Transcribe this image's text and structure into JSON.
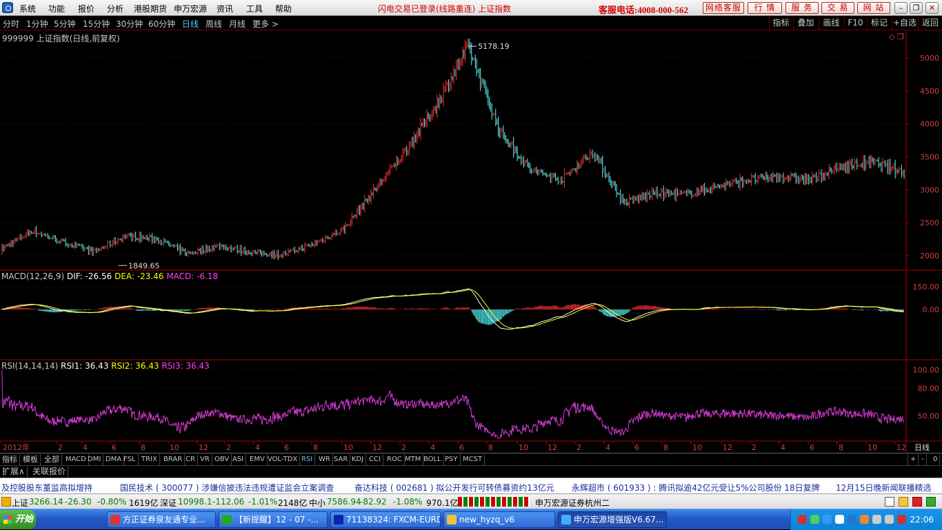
{
  "menu": {
    "items": [
      "系统",
      "功能",
      "报价",
      "分析",
      "港股期货",
      "申万宏源",
      "资讯",
      "工具",
      "帮助"
    ],
    "notice": "闪电交易已登录(线路重连)  上证指数",
    "hotline": "客服电话:4008-000-562",
    "service_buttons": [
      "网络客服",
      "行 情",
      "服 务",
      "交 易",
      "网 站"
    ]
  },
  "period_bar": {
    "items": [
      "分时",
      "1分钟",
      "5分钟",
      "15分钟",
      "30分钟",
      "60分钟",
      "日线",
      "周线",
      "月线",
      "更多 >"
    ],
    "active": "日线",
    "right_buttons": [
      "指标",
      "叠加",
      "画线",
      "F10",
      "标记",
      "+自选",
      "返回"
    ]
  },
  "main_chart": {
    "title": "999999 上证指数(日线,前复权)",
    "high_label": "5178.19",
    "low_label": "1849.65",
    "y_ticks": [
      "5000",
      "4500",
      "4000",
      "3500",
      "3000",
      "2500",
      "2000"
    ]
  },
  "macd_panel": {
    "name": "MACD(12,26,9)",
    "dif": "DIF: -26.56",
    "dea": "DEA: -23.46",
    "macd": "MACD: -6.18",
    "y_ticks": [
      "150.00",
      "0.00"
    ]
  },
  "rsi_panel": {
    "name": "RSI(14,14,14)",
    "rsi1": "RSI1: 36.43",
    "rsi2": "RSI2: 36.43",
    "rsi3": "RSI3: 36.43",
    "y_ticks": [
      "100.00",
      "80.00",
      "50.00"
    ]
  },
  "x_axis": {
    "labels": [
      "2012年",
      "2",
      "4",
      "6",
      "8",
      "10",
      "12",
      "2",
      "4",
      "6",
      "8",
      "10",
      "12",
      "2",
      "4",
      "6",
      "8",
      "10",
      "12",
      "2",
      "4",
      "6",
      "8",
      "10",
      "12",
      "2",
      "4",
      "6",
      "8",
      "10",
      "12"
    ],
    "period": "日线"
  },
  "indicator_tabs": [
    "指标",
    "模板",
    "全部",
    "MACD",
    "DMI",
    "DMA",
    "FSL",
    "TRIX",
    "BRAR",
    "CR",
    "VR",
    "OBV",
    "ASI",
    "EMV",
    "VOL-TDX",
    "RSI",
    "WR",
    "SAR",
    "KDJ",
    "CCI",
    "ROC",
    "MTM",
    "BOLL",
    "PSY",
    "MCST"
  ],
  "active_tab": "RSI",
  "tab_controls": [
    "+",
    "-",
    "0"
  ],
  "ext_tabs": [
    "扩展∧",
    "关联报价"
  ],
  "news": [
    "及控股股东董监高拟增持",
    "国民技术 ( 300077 ) 涉嫌信披违法违规遭证监会立案调查",
    "奋达科技 ( 002681 ) 拟公开发行可转债募资约13亿元",
    "永辉超市 ( 601933 ) : 腾讯拟逾42亿元受让5%公司股份 18日复牌",
    "12月15日晚新闻联播精选"
  ],
  "status": {
    "sh_label": "上证",
    "sh_value": "3266.14",
    "sh_change": "-26.30",
    "sh_pct": "-0.80%",
    "sh_amount": "1619亿",
    "sz_label": "深证",
    "sz_value": "10998.1",
    "sz_change": "-112.06",
    "sz_pct": "-1.01%",
    "sz_amount": "2148亿",
    "zx_label": "中小",
    "zx_value": "7586.94",
    "zx_change": "-82.92",
    "zx_pct": "-1.08%",
    "zx_amount": "970.1亿",
    "broker": "申万宏源证券杭州二"
  },
  "taskbar": {
    "start": "开始",
    "tasks": [
      "方正证券泉友通专业...",
      "【新提醒】12 - 07 -...",
      "71138324: FXCM-EURD...",
      "new_hyzq_v6",
      "申万宏源增强版V6.67..."
    ],
    "clock": "22:06"
  },
  "colors": {
    "up": "#ff3232",
    "down": "#54ffff",
    "grid": "#7a0000",
    "axis": "#b00000",
    "rsi": "#d23cd2",
    "dif": "#ffffff",
    "dea": "#ffff00"
  },
  "chart_data": {
    "type": "line",
    "title": "999999 上证指数(日线,前复权)",
    "x": [
      "2012-01",
      "2012-04",
      "2012-07",
      "2012-10",
      "2013-01",
      "2013-04",
      "2013-07",
      "2013-10",
      "2014-01",
      "2014-04",
      "2014-07",
      "2014-10",
      "2014-12",
      "2015-03",
      "2015-05",
      "2015-06",
      "2015-07",
      "2015-08",
      "2015-09",
      "2015-11",
      "2016-01",
      "2016-03",
      "2016-06",
      "2016-09",
      "2016-12",
      "2017-03",
      "2017-06",
      "2017-09",
      "2017-11",
      "2017-12"
    ],
    "series": [
      {
        "name": "上证指数",
        "values": [
          2100,
          2380,
          2200,
          2060,
          2300,
          2250,
          2030,
          2150,
          2050,
          2010,
          2170,
          2400,
          3000,
          3600,
          4300,
          5178,
          3900,
          3300,
          3150,
          3580,
          2800,
          2950,
          2930,
          3050,
          3150,
          3200,
          3150,
          3350,
          3420,
          3266
        ]
      }
    ],
    "ylim": [
      1800,
      5200
    ],
    "high": 5178.19,
    "low": 1849.65,
    "macd": {
      "dif": -26.56,
      "dea": -23.46,
      "macd": -6.18,
      "ylim": [
        -300,
        200
      ]
    },
    "rsi": {
      "rsi1": 36.43,
      "rsi2": 36.43,
      "rsi3": 36.43,
      "ylim": [
        25,
        105
      ]
    }
  }
}
